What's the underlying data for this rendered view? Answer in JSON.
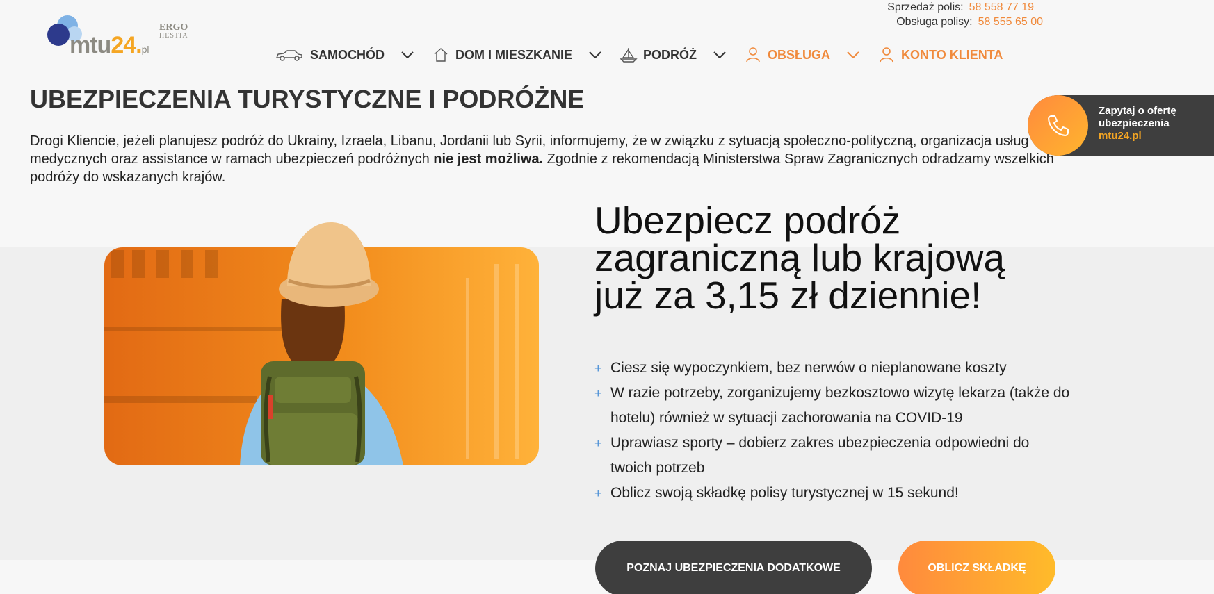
{
  "logo": {
    "word": "mtu",
    "num": "24.",
    "suffix": "pl",
    "partner_line1": "ERGO",
    "partner_line2": "HESTIA"
  },
  "contact": {
    "sales_label": "Sprzedaż polis:",
    "sales_phone": "58 558 77 19",
    "service_label": "Obsługa polisy:",
    "service_phone": "58 555 65 00"
  },
  "nav": {
    "items": [
      {
        "label": "SAMOCHÓD",
        "icon": "car-icon"
      },
      {
        "label": "DOM I MIESZKANIE",
        "icon": "house-icon"
      },
      {
        "label": "PODRÓŻ",
        "icon": "sailboat-icon"
      },
      {
        "label": "OBSŁUGA",
        "icon": "person-icon"
      },
      {
        "label": "KONTO KLIENTA",
        "icon": "person-icon"
      }
    ]
  },
  "intro": {
    "title": "UBEZPIECZENIA TURYSTYCZNE I PODRÓŻNE",
    "notice_part1": "Drogi Kliencie, jeżeli planujesz podróż do Ukrainy, Izraela, Libanu, Jordanii lub Syrii, informujemy, że w związku z sytuacją społeczno-polityczną, organizacja usług medycznych oraz assistance w ramach ubezpieczeń podróżnych ",
    "notice_bold": "nie jest możliwa.",
    "notice_part2": " Zgodnie z rekomendacją Ministerstwa Spraw Zagranicznych odradzamy wszelkich podróży do wskazanych krajów."
  },
  "cta_float": {
    "line1": "Zapytaj o ofertę",
    "line2": "ubezpieczenia",
    "line3": "mtu24.pl"
  },
  "hero": {
    "headline_line1": "Ubezpiecz podróż",
    "headline_line2": "zagraniczną lub krajową",
    "headline_line3": "już za 3,15 zł dziennie!",
    "bullets": [
      "Ciesz się wypoczynkiem, bez nerwów o nieplanowane koszty",
      "W razie potrzeby, zorganizujemy bezkosztowo wizytę lekarza (także do hotelu) również w sytuacji zachorowania na COVID-19",
      "Uprawiasz sporty – dobierz zakres ubezpieczenia odpowiedni do twoich potrzeb",
      "Oblicz swoją składkę polisy turystycznej w 15 sekund!"
    ],
    "btn_secondary": "POZNAJ UBEZPIECZENIA DODATKOWE",
    "btn_primary": "OBLICZ SKŁADKĘ"
  },
  "colors": {
    "accent_orange": "#f08a3c",
    "dark": "#3e3e3e",
    "bullet_plus": "#4a8fd6"
  }
}
